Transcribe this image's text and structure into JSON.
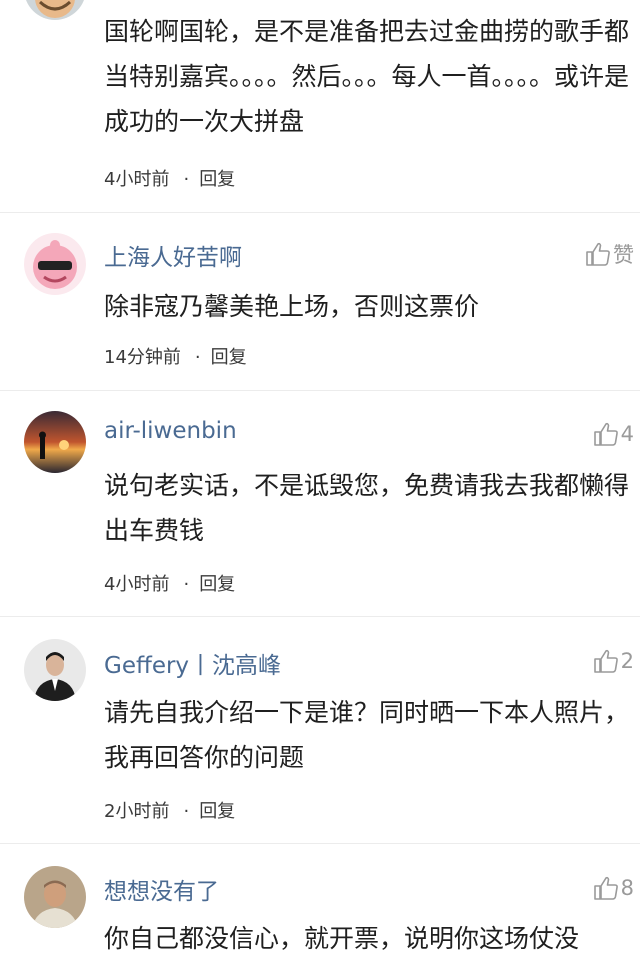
{
  "comments": [
    {
      "username": "",
      "text": "国轮啊国轮，是不是准备把去过金曲捞的歌手都当特别嘉宾。。。。然后。。。每人一首。。。。或许是成功的一次大拼盘",
      "time": "4小时前",
      "reply": "回复",
      "like": ""
    },
    {
      "username": "上海人好苦啊",
      "text": "除非寇乃馨美艳上场，否则这票价",
      "time": "14分钟前",
      "reply": "回复",
      "like": "赞"
    },
    {
      "username": "air-liwenbin",
      "text": "说句老实话，不是诋毁您，免费请我去我都懒得出车费钱",
      "time": "4小时前",
      "reply": "回复",
      "like": "4"
    },
    {
      "username": "Geffery丨沈高峰",
      "text": "请先自我介绍一下是谁？同时晒一下本人照片，我再回答你的问题",
      "time": "2小时前",
      "reply": "回复",
      "like": "2"
    },
    {
      "username": "想想没有了",
      "text": "你自己都没信心，就开票，说明你这场仗没",
      "time": "",
      "reply": "",
      "like": "8"
    }
  ],
  "colors": {
    "username": "#4a6a92",
    "text": "#1f1f1f",
    "meta": "#3a3a3a",
    "like": "#9a9a9a"
  },
  "icons": {
    "like": "thumbs-up-icon"
  }
}
